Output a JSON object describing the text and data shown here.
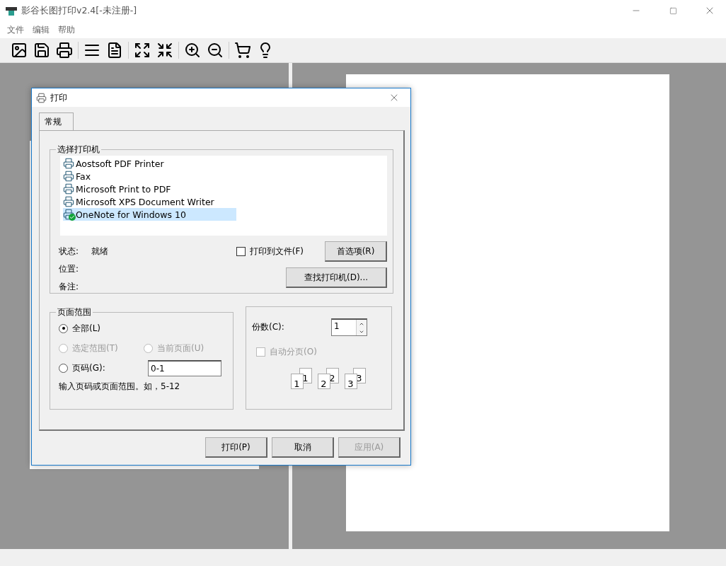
{
  "window": {
    "title": "影谷长图打印v2.4[-未注册-]"
  },
  "menu": [
    "文件",
    "编辑",
    "帮助"
  ],
  "dialog": {
    "title": "打印",
    "tabs": [
      {
        "label": "常规",
        "selected": true
      }
    ],
    "printer_group": {
      "label": "选择打印机",
      "printers": [
        {
          "name": "Aostsoft PDF Printer",
          "selected": false,
          "default": false
        },
        {
          "name": "Fax",
          "selected": false,
          "default": false
        },
        {
          "name": "Microsoft Print to PDF",
          "selected": false,
          "default": false
        },
        {
          "name": "Microsoft XPS Document Writer",
          "selected": false,
          "default": false
        },
        {
          "name": "OneNote for Windows 10",
          "selected": true,
          "default": true
        }
      ],
      "info": [
        {
          "label": "状态:",
          "value": "就绪"
        },
        {
          "label": "位置:"
        },
        {
          "label": "备注:"
        }
      ],
      "print_to_file": {
        "label": "打印到文件(F)",
        "checked": false
      },
      "preferences_button": "首选项(R)",
      "find_button": "查找打印机(D)..."
    },
    "page_range": {
      "label": "页面范围",
      "options": [
        {
          "label": "全部(L)",
          "selected": true,
          "disabled": false
        },
        {
          "label": "选定范围(T)",
          "selected": false,
          "disabled": true
        },
        {
          "label": "当前页面(U)",
          "selected": false,
          "disabled": true
        },
        {
          "label": "页码(G):",
          "selected": false,
          "disabled": false
        }
      ],
      "pages_value": "0-1",
      "hint": "输入页码或页面范围。如，5-12"
    },
    "copies": {
      "label": "份数(C):",
      "value": "1",
      "collate": {
        "label": "自动分页(O)",
        "checked": false,
        "disabled": true
      },
      "collate_pages": [
        [
          "1",
          "1"
        ],
        [
          "2",
          "2"
        ],
        [
          "3",
          "3"
        ]
      ]
    },
    "buttons": [
      {
        "label": "打印(P)",
        "disabled": false
      },
      {
        "label": "取消",
        "disabled": false
      },
      {
        "label": "应用(A)",
        "disabled": true
      }
    ]
  }
}
